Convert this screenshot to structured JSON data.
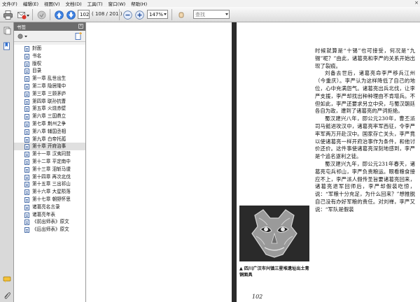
{
  "menu": {
    "items": [
      "文件(F)",
      "编辑(E)",
      "视图(V)",
      "文档(D)",
      "工具(T)",
      "窗口(W)",
      "帮助(H)"
    ],
    "close": "×"
  },
  "toolbar": {
    "page_current": "102",
    "page_total": "( 108 / 201 )",
    "zoom": "147%",
    "search_placeholder": "查找"
  },
  "panel": {
    "title": "书签",
    "close": "×"
  },
  "bookmarks": [
    "封面",
    "书名",
    "版权",
    "目录",
    "第一章  乱世出生",
    "第二章  隐居隆中",
    "第三章  三顾茅庐",
    "第四章  联孙抗曹",
    "第五章  火烧赤壁",
    "第六章  三国鼎立",
    "第七章  荆州之争",
    "第八章  辅国丞相",
    "第九章  白帝托孤",
    "第十章  开府治事",
    "第十一章  汉夷同盟",
    "第十二章  平定南中",
    "第十三章  泪斩马谡",
    "第十四章  再次北伐",
    "第十五章  三出祁山",
    "第十六章  大星陨落",
    "第十七章  朝野怀思",
    "诸葛亮名言录",
    "诸葛亮年表",
    "《前出师表》原文",
    "《后出师表》原文"
  ],
  "document": {
    "paragraphs": [
      "时候就算是“十锡”也可接受，何况是“九锡”呢？”由此，诸葛亮和李严的关系开始出现了裂痕。",
      "刘备去世后，诸葛亮命李严移兵江州（今重庆）。李严认为这样降低了自己的地位，心中充满怨气。诸葛亮出兵北伐，让李严支援，李严却找出种种理由不肯增兵。不但如此，李严还要求另立中央，与蜀汉朝廷各自为政，遭到了诸葛亮的严词拒绝。",
      "蜀汉建兴八年，即公元230年，曹丕派司马懿进攻汉中，诸葛亮率军西征，令李严率军两万开赴汉中。国家存亡关头，李严竟以使诸葛亮一样开府治事作为条件，和他讨价还价。这件事使诸葛亮深刻地感到，李严是个追名逐利之徒。",
      "蜀汉建兴九年，即公元231年春天，诸葛亮屯兵祁山，李严负责粮运。眼看粮食接应不上，李严派人假传圣旨要诸葛亮回来，诸葛亮退军回师后，李严却假装吃惊，说：“军粮十分充足，为什么回来？”想推脱自己没有办好军粮的责任。对刘禅，李严又说：“军队是假装"
    ],
    "caption": "▲ 四川广汉市兴镇三星堆遗址出土青铜面具",
    "page_number": "102"
  },
  "icons": {
    "print": "printer-icon",
    "email": "email-icon",
    "save": "save-icon",
    "prev": "previous-page-icon",
    "next": "next-page-icon",
    "zoom_out": "zoom-out-icon",
    "zoom_in": "zoom-in-icon"
  },
  "colors": {
    "panel_header": "#6c6c6c",
    "gutter": "#2b2b2b",
    "nav_arrow": "#2f6fd0"
  }
}
